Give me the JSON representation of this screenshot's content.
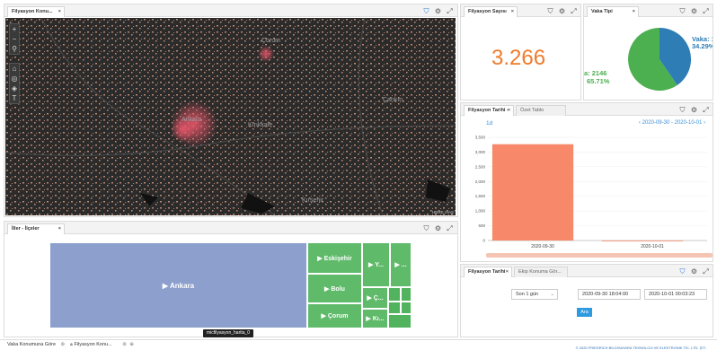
{
  "map_panel": {
    "tab": "Filyasyon Konu...",
    "cities": [
      "Çorum",
      "Ankara",
      "Kırıkkale",
      "Kırşehir",
      "Çankırı"
    ],
    "attribution": "HERE VIAS",
    "controls": [
      "+",
      "−",
      "⚲",
      "⌂",
      "◎",
      "◈",
      "T"
    ]
  },
  "ilceler_panel": {
    "tab": "İller - İlçeler"
  },
  "treemap": [
    {
      "label": "▶ Ankara"
    },
    {
      "label": "▶ Eskişehir"
    },
    {
      "label": "▶ Y..."
    },
    {
      "label": "▶ ..."
    },
    {
      "label": "▶ Bolu"
    },
    {
      "label": "▶ Ç..."
    },
    {
      "label": "▶ Çorum"
    },
    {
      "label": "▶ Kı..."
    }
  ],
  "treemap_tooltip": "micfilyasyon_harita_0",
  "sayisi_panel": {
    "tab": "Filyasyon Sayısı",
    "value": "3.266"
  },
  "vaka_panel": {
    "tab": "Vaka Tipi",
    "slice_a_label": "Vaka: 1",
    "slice_a_pct": "34.29%",
    "slice_b_label": "a: 2146",
    "slice_b_pct": "65.71%"
  },
  "tarih_panel": {
    "tab1": "Filyasyon Tarihi - ",
    "tab2": "Özet Tablo",
    "granularity": "1d",
    "range": "2020-09-30 - 2020-10-01"
  },
  "chart_data": {
    "type": "bar",
    "categories": [
      "2020-09-30",
      "2020-10-01"
    ],
    "values": [
      3266,
      0
    ],
    "ylim": [
      0,
      3500
    ],
    "yticks": [
      "0",
      "500",
      "1,000",
      "1,500",
      "2,000",
      "2,500",
      "3,000",
      "3,500"
    ],
    "color": "#f7896a"
  },
  "filter_panel": {
    "tab1": "Filyasyon Tarihi",
    "tab2": "Ekip Konuma Gör...",
    "period": "Son 1 gün",
    "start": "2020-09-30 18:04:00",
    "end": "2020-10-01 00:03:23",
    "button": "Ara"
  },
  "bottom": {
    "tab1": "Vaka Konumuna Göre",
    "tab2": "Filyasyon Konu...",
    "copyright": "© 2020 FRIEDRICH BILGISAYARA TEKNOLOJI VE ELEKTRONIK TİC. LTD. ŞTİ."
  }
}
